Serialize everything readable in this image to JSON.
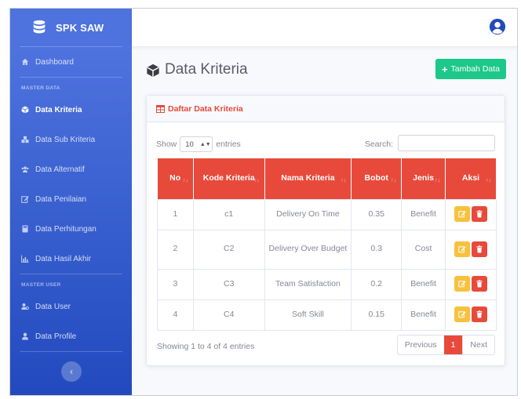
{
  "brand": {
    "name": "SPK SAW"
  },
  "sidebar": {
    "dashboard": "Dashboard",
    "heading_master_data": "MASTER DATA",
    "items_data": [
      {
        "label": "Data Kriteria",
        "icon": "cube-icon",
        "active": true
      },
      {
        "label": "Data Sub Kriteria",
        "icon": "cubes-icon"
      },
      {
        "label": "Data Alternatif",
        "icon": "users-icon"
      },
      {
        "label": "Data Penilaian",
        "icon": "edit-icon"
      },
      {
        "label": "Data Perhitungan",
        "icon": "calculator-icon"
      },
      {
        "label": "Data Hasil Akhir",
        "icon": "chart-icon"
      }
    ],
    "heading_master_user": "MASTER USER",
    "items_user": [
      {
        "label": "Data User",
        "icon": "users-cog-icon"
      },
      {
        "label": "Data Profile",
        "icon": "user-icon"
      }
    ],
    "toggle_glyph": "‹"
  },
  "page": {
    "title": "Data Kriteria",
    "add_button": "Tambah Data"
  },
  "card": {
    "header": "Daftar Data Kriteria",
    "show_prefix": "Show",
    "entries_value": "10",
    "show_suffix": "entries",
    "search_label": "Search:",
    "search_placeholder": ""
  },
  "table": {
    "headers": [
      "No",
      "Kode Kriteria",
      "Nama Kriteria",
      "Bobot",
      "Jenis",
      "Aksi"
    ],
    "rows": [
      {
        "no": "1",
        "kode": "c1",
        "nama": "Delivery On Time",
        "bobot": "0.35",
        "jenis": "Benefit"
      },
      {
        "no": "2",
        "kode": "C2",
        "nama": "Delivery Over Budget",
        "bobot": "0.3",
        "jenis": "Cost"
      },
      {
        "no": "3",
        "kode": "C3",
        "nama": "Team Satisfaction",
        "bobot": "0.2",
        "jenis": "Benefit"
      },
      {
        "no": "4",
        "kode": "C4",
        "nama": "Soft Skill",
        "bobot": "0.15",
        "jenis": "Benefit"
      }
    ]
  },
  "footer": {
    "info": "Showing 1 to 4 of 4 entries",
    "previous": "Previous",
    "page_1": "1",
    "next": "Next"
  },
  "colors": {
    "sidebar": "#4e73df",
    "accent_red": "#e74a3b",
    "success": "#1cc88a",
    "warning": "#f6c23e"
  }
}
